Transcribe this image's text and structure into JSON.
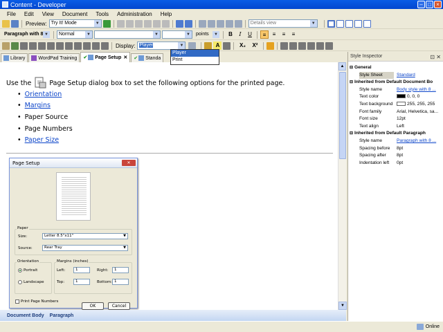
{
  "window": {
    "title": "Content - Developer"
  },
  "menu": [
    "File",
    "Edit",
    "View",
    "Document",
    "Tools",
    "Administration",
    "Help"
  ],
  "toolbar1": {
    "preview_label": "Preview:",
    "preview_mode": "Try It! Mode",
    "view_mode": "Details view"
  },
  "toolbar2": {
    "paragraph_style": "Paragraph with 8 ...",
    "char_style": "Normal",
    "size_unit": "points",
    "bold": "B",
    "italic": "I",
    "underline": "U"
  },
  "toolbar3": {
    "display_label": "Display:",
    "display_value": "Player",
    "highlight": "A",
    "subscript": "X₂",
    "superscript": "X²"
  },
  "display_dropdown": {
    "options": [
      "Player",
      "Print"
    ],
    "selected": "Player"
  },
  "tabs": [
    {
      "label": "Library"
    },
    {
      "label": "WordPad Training"
    },
    {
      "label": "Page Setup"
    },
    {
      "label": "Standa"
    }
  ],
  "document": {
    "intro_before": "Use the",
    "intro_after": "Page Setup dialog box to set the following options for the printed page.",
    "items": [
      {
        "text": "Orientation",
        "link": true
      },
      {
        "text": "Margins",
        "link": true
      },
      {
        "text": "Paper Source",
        "link": false
      },
      {
        "text": "Page Numbers",
        "link": false
      },
      {
        "text": "Paper Size",
        "link": true
      }
    ]
  },
  "dialog": {
    "title": "Page Setup",
    "paper_group": "Paper",
    "size_label": "Size:",
    "size_value": "Letter 8.5\"x11\"",
    "source_label": "Source:",
    "source_value": "Rear Tray",
    "orientation_group": "Orientation",
    "portrait": "Portrait",
    "landscape": "Landscape",
    "margins_group": "Margins (inches)",
    "left_label": "Left:",
    "left_value": "1",
    "right_label": "Right:",
    "right_value": "1",
    "top_label": "Top:",
    "top_value": "1",
    "bottom_label": "Bottom:",
    "bottom_value": "1",
    "print_page_numbers": "Print Page Numbers",
    "ok": "OK",
    "cancel": "Cancel"
  },
  "status": {
    "items": [
      "Document Body",
      "Paragraph"
    ]
  },
  "inspector": {
    "title": "Style Inspector",
    "rows": [
      {
        "kind": "head",
        "key": "General",
        "tog": "⊟"
      },
      {
        "kind": "row",
        "key": "Style Sheet",
        "value": "Standard",
        "link": true,
        "selected": true
      },
      {
        "kind": "head",
        "key": "Inherited from Default Document Bo",
        "tog": "⊟"
      },
      {
        "kind": "row",
        "key": "Style name",
        "value": "Body style with 8 ...",
        "link": true
      },
      {
        "kind": "row",
        "key": "Text color",
        "value": "0, 0, 0",
        "swatch": "#000000"
      },
      {
        "kind": "row",
        "key": "Text background",
        "value": "255, 255, 255",
        "swatch": "#ffffff"
      },
      {
        "kind": "row",
        "key": "Font family",
        "value": "Arial, Helvetica, sa..."
      },
      {
        "kind": "row",
        "key": "Font size",
        "value": "12pt"
      },
      {
        "kind": "row",
        "key": "Text align",
        "value": "Left"
      },
      {
        "kind": "head",
        "key": "Inherited from Default Paragraph",
        "tog": "⊟"
      },
      {
        "kind": "row",
        "key": "Style name",
        "value": "Paragraph with 8 ...",
        "link": true
      },
      {
        "kind": "row",
        "key": "Spacing before",
        "value": "8pt"
      },
      {
        "kind": "row",
        "key": "Spacing after",
        "value": "8pt"
      },
      {
        "kind": "row",
        "key": "Indentation left",
        "value": "0pt"
      }
    ]
  },
  "bottom": {
    "online": "Online"
  }
}
